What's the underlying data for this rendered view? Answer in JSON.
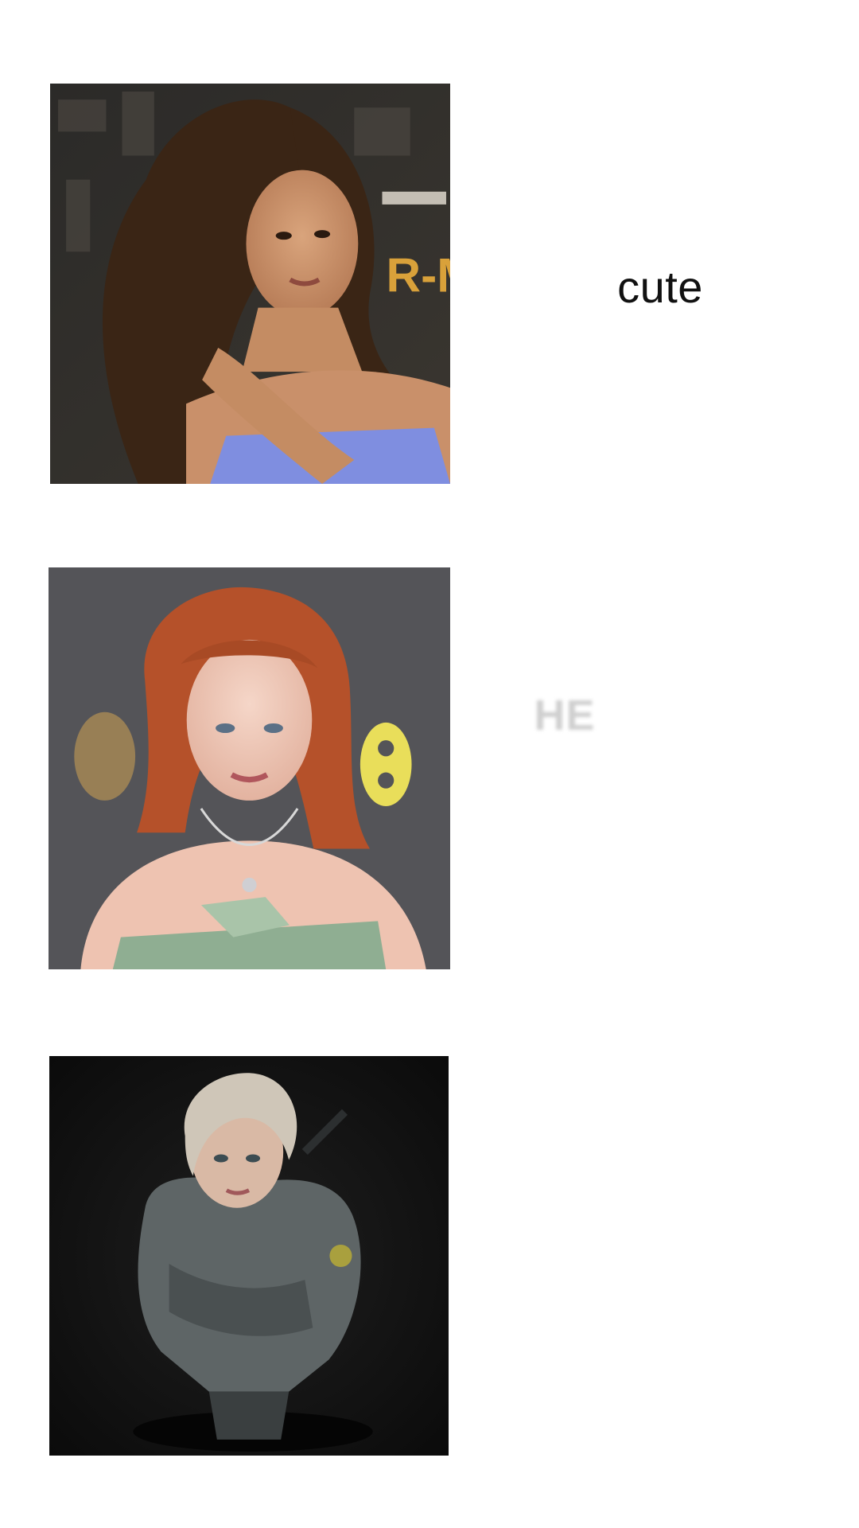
{
  "panels": [
    {
      "caption": "cute",
      "photo": "portrait-curly-hair-premiere"
    },
    {
      "caption": "HE",
      "photo": "portrait-red-hair-awards"
    },
    {
      "caption": "",
      "photo": "portrait-platinum-hair-costume"
    }
  ],
  "colors": {
    "background": "#ffffff",
    "caption_text": "#111111",
    "faded_caption": "#cfcfcf"
  }
}
